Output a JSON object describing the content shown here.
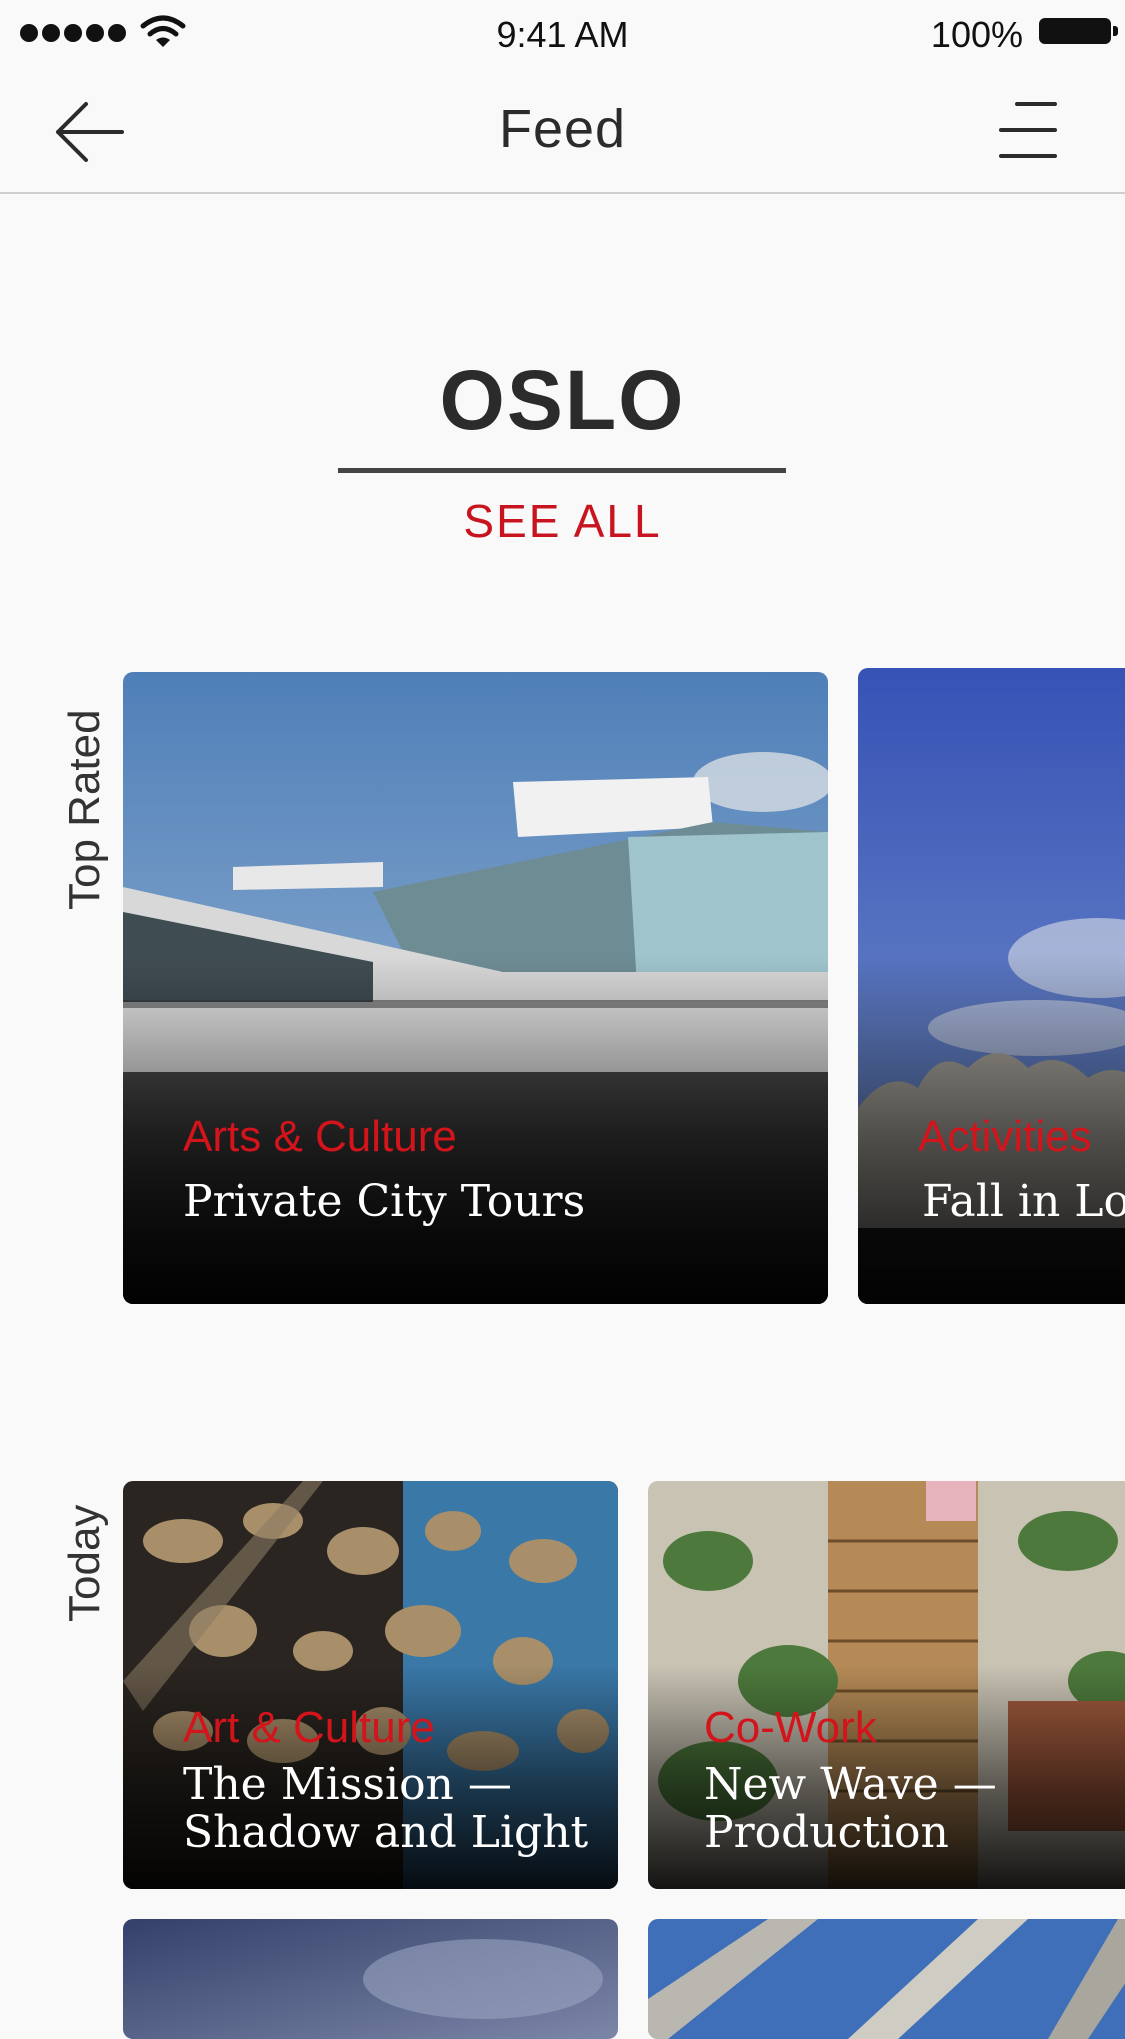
{
  "status_bar": {
    "time": "9:41 AM",
    "battery": "100%"
  },
  "nav": {
    "title": "Feed"
  },
  "city": {
    "name": "OSLO",
    "see_all": "SEE ALL"
  },
  "sections": {
    "top_rated": {
      "label": "Top Rated",
      "cards": [
        {
          "category": "Arts & Culture",
          "title": "Private City Tours"
        },
        {
          "category": "Activities",
          "title": "Fall in Lov"
        }
      ]
    },
    "today": {
      "label": "Today",
      "cards": [
        {
          "category": "Art & Culture",
          "title_line1": "The Mission —",
          "title_line2": "Shadow and Light"
        },
        {
          "category": "Co-Work",
          "title_line1": "New Wave —",
          "title_line2": "Production"
        }
      ]
    }
  },
  "colors": {
    "accent": "#c8141e",
    "text": "#2b2b2b",
    "background": "#f9f9f9"
  }
}
